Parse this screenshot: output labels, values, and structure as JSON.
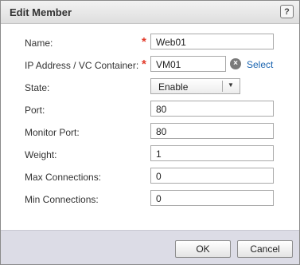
{
  "dialog": {
    "title": "Edit Member",
    "help_label": "?"
  },
  "form": {
    "name": {
      "label": "Name:",
      "value": "Web01",
      "required_mark": "*"
    },
    "ip_address": {
      "label": "IP Address / VC Container:",
      "value": "VM01",
      "required_mark": "*",
      "clear_label": "×",
      "select_link": "Select"
    },
    "state": {
      "label": "State:",
      "selected": "Enable",
      "caret": "▼"
    },
    "port": {
      "label": "Port:",
      "value": "80"
    },
    "monitor_port": {
      "label": "Monitor Port:",
      "value": "80"
    },
    "weight": {
      "label": "Weight:",
      "value": "1"
    },
    "max_connections": {
      "label": "Max Connections:",
      "value": "0"
    },
    "min_connections": {
      "label": "Min Connections:",
      "value": "0"
    }
  },
  "footer": {
    "ok_label": "OK",
    "cancel_label": "Cancel"
  },
  "colors": {
    "required": "#e23a2a",
    "link": "#1a64b0",
    "footer_bg": "#dcdce6"
  }
}
